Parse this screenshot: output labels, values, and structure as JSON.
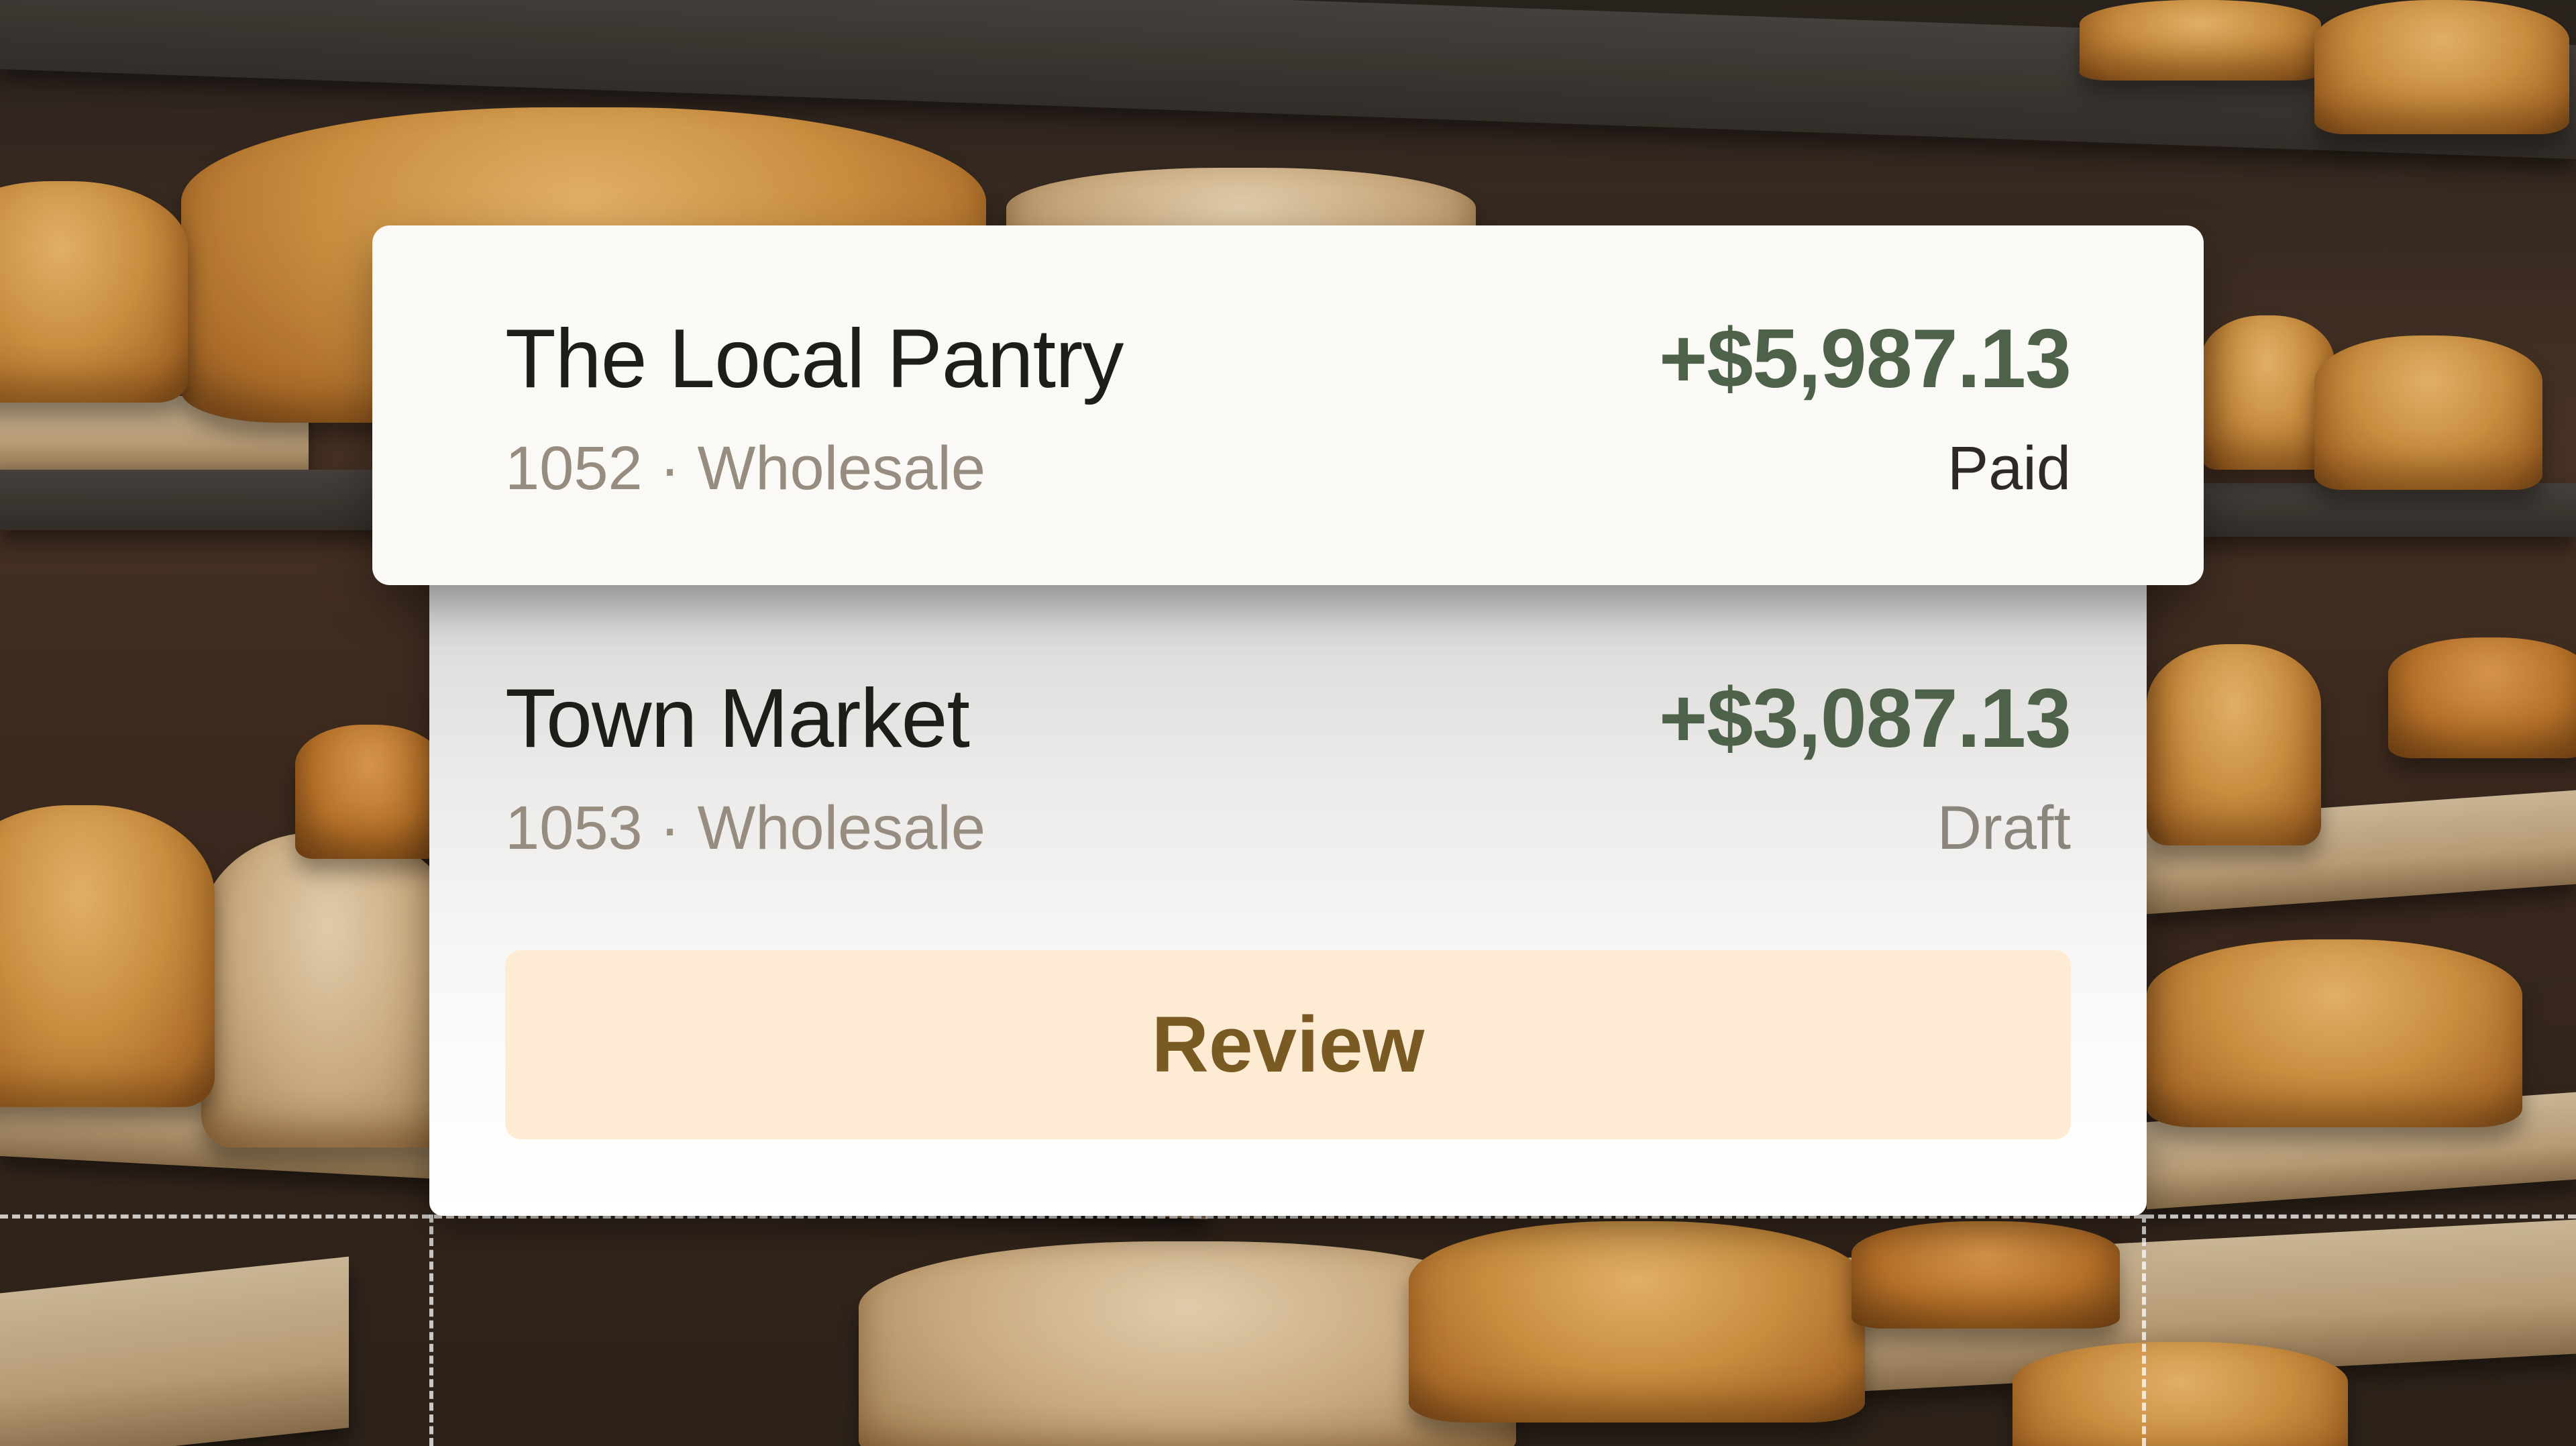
{
  "transactions": [
    {
      "name": "The Local Pantry",
      "id": "1052",
      "separator": "·",
      "type": "Wholesale",
      "amount": "+$5,987.13",
      "status": "Paid"
    },
    {
      "name": "Town Market",
      "id": "1053",
      "separator": "·",
      "type": "Wholesale",
      "amount": "+$3,087.13",
      "status": "Draft"
    }
  ],
  "review": {
    "label": "Review"
  },
  "colors": {
    "amount": "#4e6149",
    "review_bg": "#fdebd4",
    "review_text": "#7a5a23",
    "card_bg": "#fbf9f5"
  },
  "background": {
    "subject": "cheese-wheels-on-aging-shelves"
  }
}
